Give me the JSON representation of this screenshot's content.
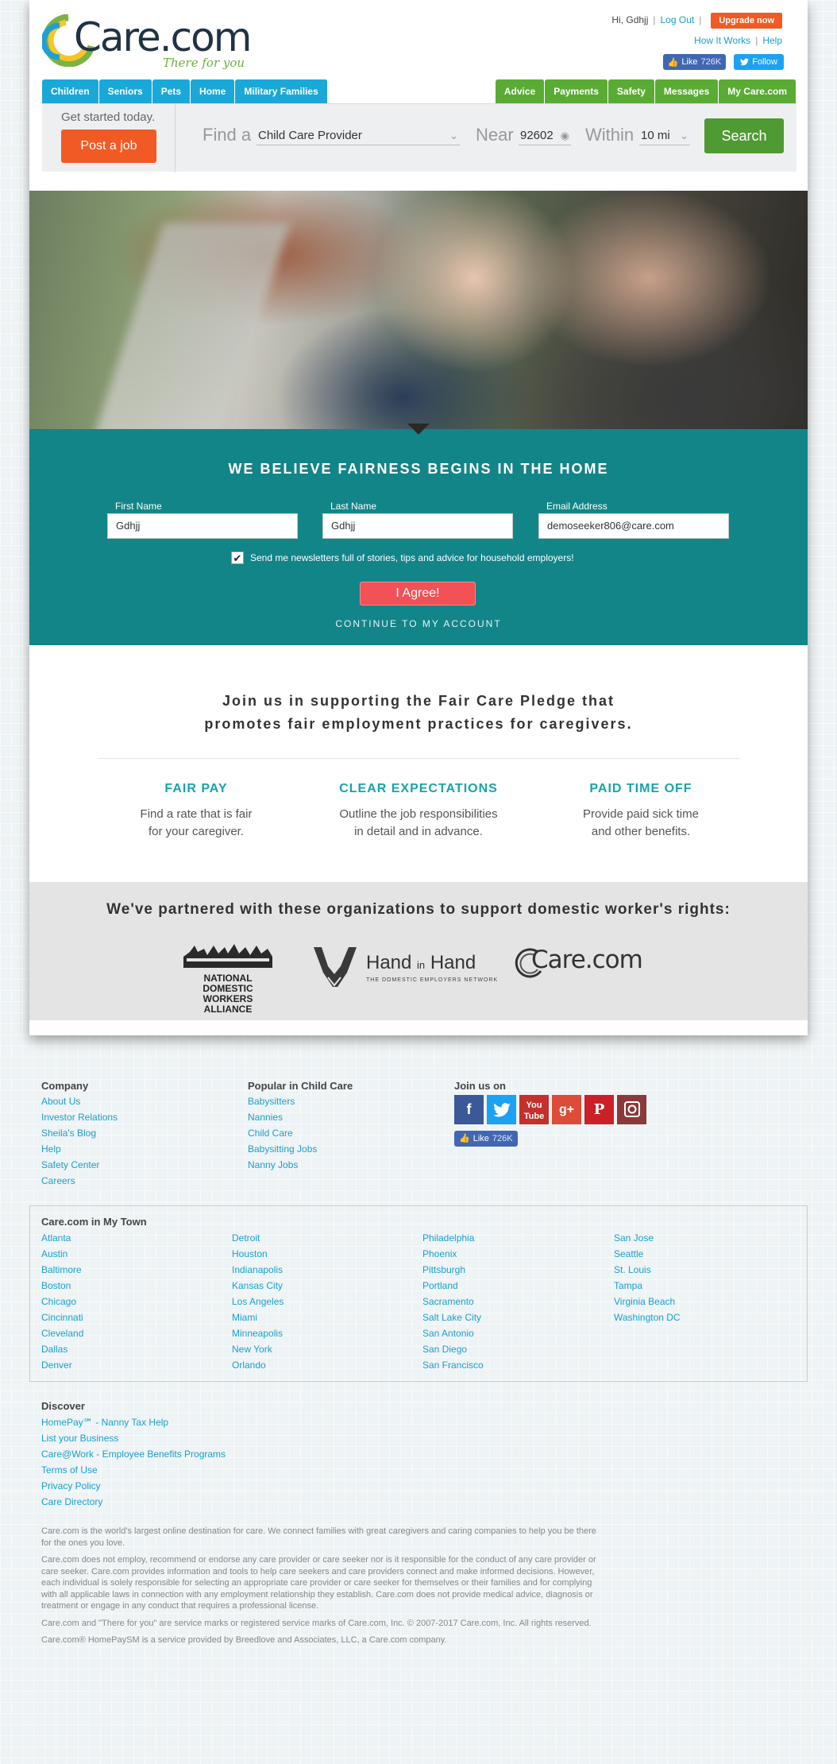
{
  "header": {
    "logo_text": "Care.com",
    "tagline": "There for you",
    "greeting": "Hi, Gdhjj",
    "logout": "Log Out",
    "upgrade": "Upgrade now",
    "how_it_works": "How It Works",
    "help": "Help",
    "fb_like": "Like",
    "fb_count": "726K",
    "tw_follow": "Follow"
  },
  "nav": {
    "left": [
      "Children",
      "Seniors",
      "Pets",
      "Home",
      "Military Families"
    ],
    "right": [
      "Advice",
      "Payments",
      "Safety",
      "Messages",
      "My Care.com"
    ]
  },
  "search": {
    "get_started": "Get started today.",
    "post_job": "Post a job",
    "find_label": "Find a",
    "find_value": "Child Care Provider",
    "near_label": "Near",
    "near_value": "92602",
    "within_label": "Within",
    "within_value": "10 mi",
    "search_button": "Search"
  },
  "form": {
    "title": "WE BELIEVE FAIRNESS BEGINS IN THE HOME",
    "first_name_label": "First Name",
    "first_name_value": "Gdhjj",
    "last_name_label": "Last Name",
    "last_name_value": "Gdhjj",
    "email_label": "Email Address",
    "email_value": "demoseeker806@care.com",
    "newsletter_text": "Send me newsletters full of stories, tips and advice for household employers!",
    "agree_button": "I Agree!",
    "continue_link": "CONTINUE TO MY ACCOUNT"
  },
  "pledge": {
    "title_line1": "Join us in supporting the Fair Care Pledge that",
    "title_line2": "promotes fair employment practices for caregivers.",
    "columns": [
      {
        "title": "FAIR PAY",
        "line1": "Find a rate that is fair",
        "line2": "for your caregiver."
      },
      {
        "title": "CLEAR EXPECTATIONS",
        "line1": "Outline the job responsibilities",
        "line2": "in detail and in advance."
      },
      {
        "title": "PAID TIME OFF",
        "line1": "Provide paid sick time",
        "line2": "and other benefits."
      }
    ]
  },
  "partners": {
    "title": "We've partnered with these organizations to support domestic worker's rights:",
    "ndwa_line1": "NATIONAL DOMESTIC",
    "ndwa_line2": "WORKERS ALLIANCE",
    "hih_hand": "Hand",
    "hih_in": "in",
    "hih_hand2": "Hand",
    "hih_sub": "THE DOMESTIC EMPLOYERS NETWORK",
    "care_logo": "Care.com"
  },
  "footer": {
    "company": {
      "title": "Company",
      "links": [
        "About Us",
        "Investor Relations",
        "Sheila's Blog",
        "Help",
        "Safety Center",
        "Careers"
      ]
    },
    "popular": {
      "title": "Popular in Child Care",
      "links": [
        "Babysitters",
        "Nannies",
        "Child Care",
        "Babysitting Jobs",
        "Nanny Jobs"
      ]
    },
    "join": {
      "title": "Join us on",
      "fb_like": "Like",
      "fb_count": "726K"
    },
    "mytown": {
      "title": "Care.com in My Town",
      "col1": [
        "Atlanta",
        "Austin",
        "Baltimore",
        "Boston",
        "Chicago",
        "Cincinnati",
        "Cleveland",
        "Dallas",
        "Denver"
      ],
      "col2": [
        "Detroit",
        "Houston",
        "Indianapolis",
        "Kansas City",
        "Los Angeles",
        "Miami",
        "Minneapolis",
        "New York",
        "Orlando"
      ],
      "col3": [
        "Philadelphia",
        "Phoenix",
        "Pittsburgh",
        "Portland",
        "Sacramento",
        "Salt Lake City",
        "San Antonio",
        "San Diego",
        "San Francisco"
      ],
      "col4": [
        "San Jose",
        "Seattle",
        "St. Louis",
        "Tampa",
        "Virginia Beach",
        "Washington DC"
      ]
    },
    "discover": {
      "title": "Discover",
      "links": [
        "HomePay℠ - Nanny Tax Help",
        "List your Business",
        "Care@Work - Employee Benefits Programs",
        "Terms of Use",
        "Privacy Policy",
        "Care Directory"
      ]
    },
    "legal": [
      "Care.com is the world's largest online destination for care. We connect families with great caregivers and caring companies to help you be there for the ones you love.",
      "Care.com does not employ, recommend or endorse any care provider or care seeker nor is it responsible for the conduct of any care provider or care seeker. Care.com provides information and tools to help care seekers and care providers connect and make informed decisions. However, each individual is solely responsible for selecting an appropriate care provider or care seeker for themselves or their families and for complying with all applicable laws in connection with any employment relationship they establish. Care.com does not provide medical advice, diagnosis or treatment or engage in any conduct that requires a professional license.",
      "Care.com and \"There for you\" are service marks or registered service marks of Care.com, Inc. © 2007-2017 Care.com, Inc. All rights reserved.",
      "Care.com® HomePaySM is a service provided by Breedlove and Associates, LLC, a Care.com company."
    ]
  },
  "colors": {
    "teal": "#128589",
    "orange": "#f15a24",
    "nav_blue": "#1aa8d8",
    "nav_green": "#5aab33",
    "link": "#1a9fc9"
  }
}
